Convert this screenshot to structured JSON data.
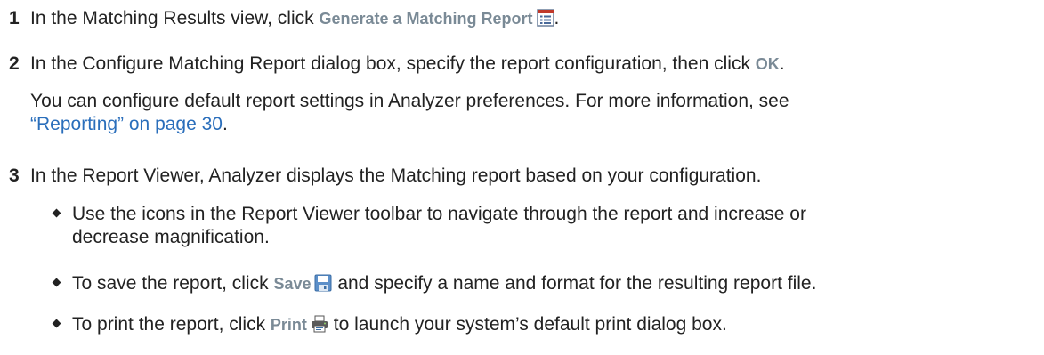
{
  "steps": [
    {
      "num": "1",
      "pre": "In the Matching Results view, click ",
      "ui": "Generate a Matching Report",
      "icon": "report-list-icon",
      "post": "."
    },
    {
      "num": "2",
      "pre": "In the Configure Matching Report dialog box, specify the report configuration, then click ",
      "ui": "OK",
      "post": ".",
      "note_line1": "You can configure default report settings in Analyzer preferences. For more information, see",
      "note_link": "“Reporting” on page 30",
      "note_post": "."
    },
    {
      "num": "3",
      "text": "In the Report Viewer, Analyzer displays the Matching report based on your configuration.",
      "bullets": [
        {
          "line1": "Use the icons in the Report Viewer toolbar to navigate through the report and increase or",
          "line2": "decrease magnification."
        },
        {
          "pre": "To save the report, click ",
          "ui": "Save",
          "icon": "floppy-disk-icon",
          "post": " and specify a name and format for the resulting report file."
        },
        {
          "pre": "To print the report, click ",
          "ui": "Print",
          "icon": "printer-icon",
          "post": " to launch your system’s default print dialog box."
        }
      ]
    }
  ]
}
